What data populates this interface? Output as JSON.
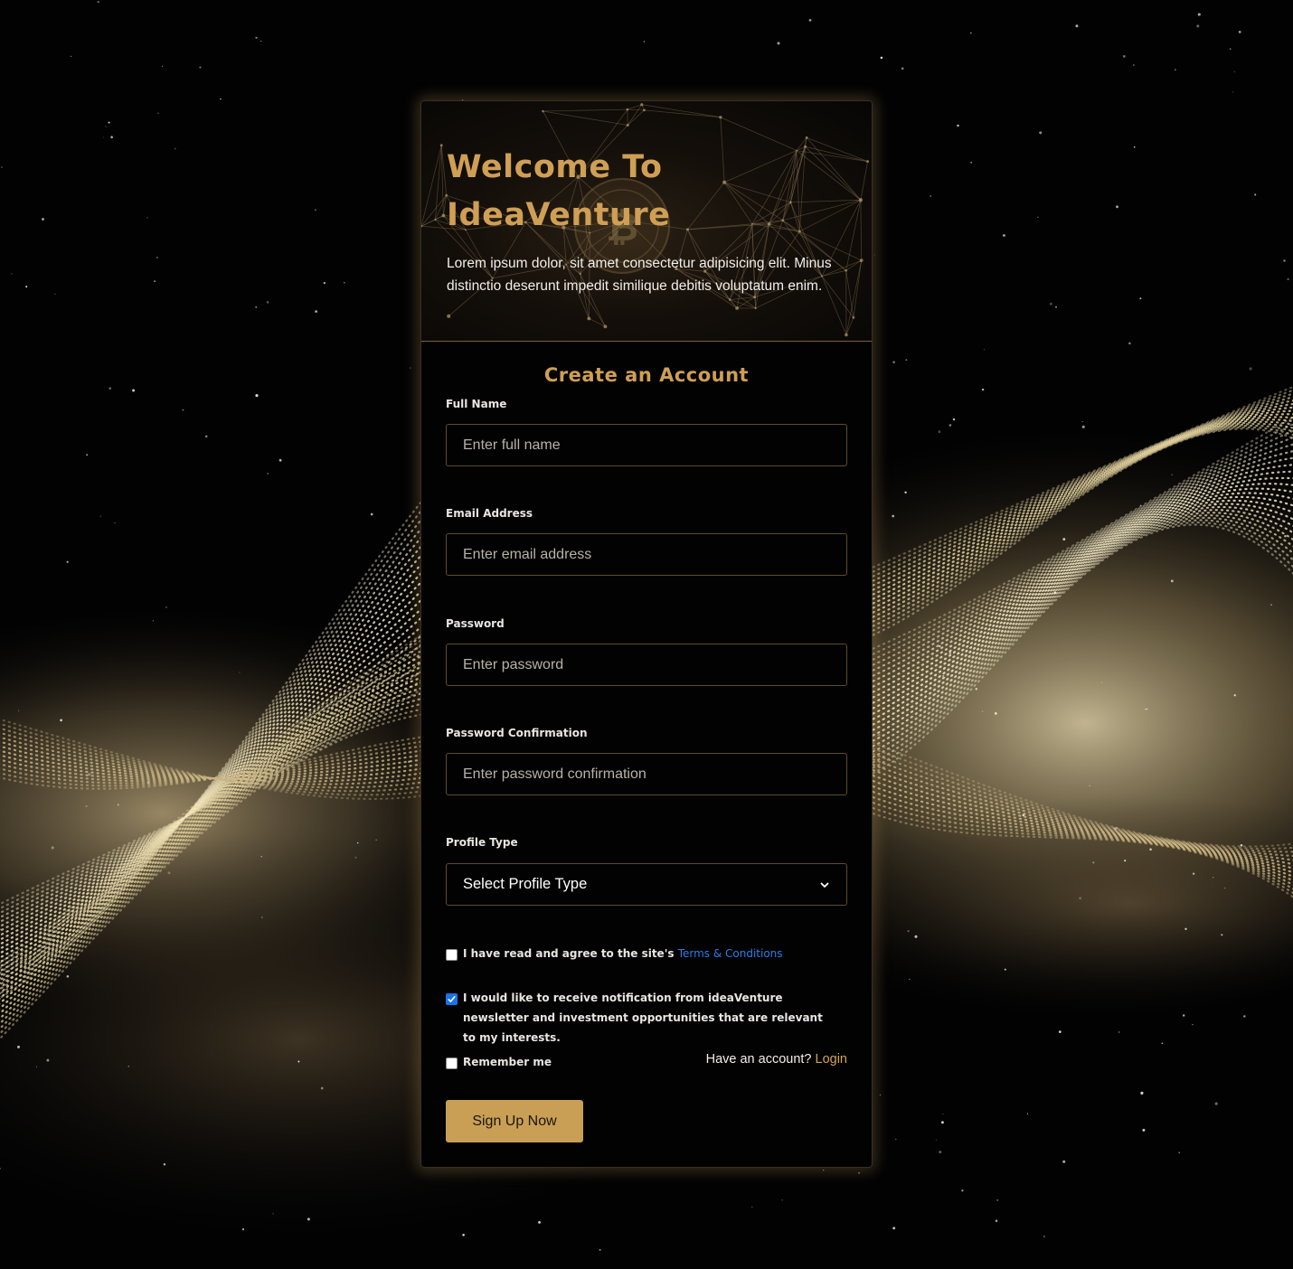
{
  "hero": {
    "title_line1": "Welcome To",
    "title_line2": "IdeaVenture",
    "description": "Lorem ipsum dolor, sit amet consectetur adipisicing elit. Minus distinctio deserunt impedit similique debitis voluptatum enim."
  },
  "form": {
    "title": "Create an Account",
    "full_name": {
      "label": "Full Name",
      "placeholder": "Enter full name",
      "value": ""
    },
    "email": {
      "label": "Email Address",
      "placeholder": "Enter email address",
      "value": ""
    },
    "password": {
      "label": "Password",
      "placeholder": "Enter password",
      "value": ""
    },
    "password_confirmation": {
      "label": "Password Confirmation",
      "placeholder": "Enter password confirmation",
      "value": ""
    },
    "profile_type": {
      "label": "Profile Type",
      "selected": "Select Profile Type"
    },
    "terms": {
      "text": "I have read and agree to the site's",
      "link": "Terms & Conditions",
      "checked": false
    },
    "newsletter": {
      "text": "I would like to receive notification from ideaVenture newsletter and investment opportunities that are relevant to my interests.",
      "checked": true
    },
    "remember": {
      "text": "Remember me",
      "checked": false
    },
    "have_account": {
      "text": "Have an account?",
      "link": "Login"
    },
    "submit_label": "Sign Up Now"
  },
  "colors": {
    "accent_gold": "#cf9f55",
    "button_gold": "#c99f55",
    "link_blue": "#2c7de8",
    "background": "#020203"
  },
  "icons": {
    "select": "chevron-down-icon",
    "checkbox_checked": "checkmark-icon",
    "hero_emblem": "bitcoin-icon"
  }
}
